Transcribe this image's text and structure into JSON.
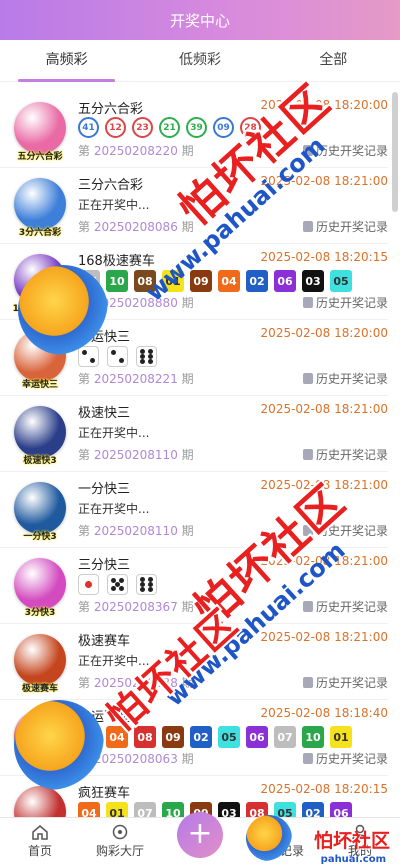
{
  "header": {
    "title": "开奖中心"
  },
  "tabs": [
    "高频彩",
    "低频彩",
    "全部"
  ],
  "active_tab": 0,
  "history_label": "历史开奖记录",
  "period_prefix": "第",
  "period_suffix": "期",
  "rows": [
    {
      "name": "五分六合彩",
      "logo_text": "五分六合彩",
      "logo_color": "#e96aa4",
      "time": "2025-02-08 18:20:00",
      "result_type": "balls",
      "balls": [
        {
          "n": "41",
          "c": "blue"
        },
        {
          "n": "12",
          "c": "red"
        },
        {
          "n": "23",
          "c": "red"
        },
        {
          "n": "21",
          "c": "green"
        },
        {
          "n": "39",
          "c": "green"
        },
        {
          "n": "09",
          "c": "blue"
        },
        {
          "n": "28",
          "c": "red"
        }
      ],
      "period": "20250208220"
    },
    {
      "name": "三分六合彩",
      "logo_text": "3分六合彩",
      "logo_color": "#3d7fd9",
      "time": "2025-02-08 18:21:00",
      "result_type": "status",
      "status": "正在开奖中...",
      "period": "20250208086"
    },
    {
      "name": "168极速赛车",
      "logo_text": "168极速赛车",
      "logo_color": "#7a3cc4",
      "time": "2025-02-08 18:20:15",
      "result_type": "squares",
      "squares": [
        {
          "n": "07",
          "bg": "#bdbdbd",
          "fg": "#fff"
        },
        {
          "n": "10",
          "bg": "#2aa74a",
          "fg": "#fff"
        },
        {
          "n": "08",
          "bg": "#7a4a1e",
          "fg": "#fff"
        },
        {
          "n": "01",
          "bg": "#f5e11c",
          "fg": "#333"
        },
        {
          "n": "09",
          "bg": "#8a3a10",
          "fg": "#fff"
        },
        {
          "n": "04",
          "bg": "#f06a1a",
          "fg": "#fff"
        },
        {
          "n": "02",
          "bg": "#1f5fc6",
          "fg": "#fff"
        },
        {
          "n": "06",
          "bg": "#8b2fd6",
          "fg": "#fff"
        },
        {
          "n": "03",
          "bg": "#111",
          "fg": "#fff"
        },
        {
          "n": "05",
          "bg": "#3fe0e0",
          "fg": "#333"
        }
      ],
      "period": "20250208880"
    },
    {
      "name": "幸运快三",
      "logo_text": "幸运快三",
      "logo_color": "#d9633a",
      "time": "2025-02-08 18:20:00",
      "result_type": "dice",
      "dice": [
        2,
        2,
        6
      ],
      "period": "20250208221"
    },
    {
      "name": "极速快三",
      "logo_text": "极速快3",
      "logo_color": "#2b3e8a",
      "time": "2025-02-08 18:21:00",
      "result_type": "status",
      "status": "正在开奖中...",
      "period": "20250208110"
    },
    {
      "name": "一分快三",
      "logo_text": "一分快3",
      "logo_color": "#1f5a9e",
      "time": "2025-02-08 18:21:00",
      "result_type": "status",
      "status": "正在开奖中...",
      "period": "20250208110"
    },
    {
      "name": "三分快三",
      "logo_text": "3分快3",
      "logo_color": "#d34bbf",
      "time": "2025-02-08 18:21:00",
      "result_type": "dice",
      "dice": [
        1,
        5,
        6
      ],
      "period": "20250208367"
    },
    {
      "name": "极速赛车",
      "logo_text": "极速赛车",
      "logo_color": "#c4451e",
      "time": "2025-02-08 18:21:00",
      "result_type": "status",
      "status": "正在开奖中...",
      "period": "20250208538"
    },
    {
      "name": "幸运飞艇",
      "logo_text": "幸运飞艇",
      "logo_color": "#d8383a",
      "time": "2025-02-08 18:18:40",
      "result_type": "squares",
      "squares": [
        {
          "n": "03",
          "bg": "#111",
          "fg": "#fff"
        },
        {
          "n": "04",
          "bg": "#f06a1a",
          "fg": "#fff"
        },
        {
          "n": "08",
          "bg": "#d73030",
          "fg": "#fff"
        },
        {
          "n": "09",
          "bg": "#8a3a10",
          "fg": "#fff"
        },
        {
          "n": "02",
          "bg": "#1f5fc6",
          "fg": "#fff"
        },
        {
          "n": "05",
          "bg": "#3fe0e0",
          "fg": "#333"
        },
        {
          "n": "06",
          "bg": "#8b2fd6",
          "fg": "#fff"
        },
        {
          "n": "07",
          "bg": "#bdbdbd",
          "fg": "#fff"
        },
        {
          "n": "10",
          "bg": "#2aa74a",
          "fg": "#fff"
        },
        {
          "n": "01",
          "bg": "#f5e11c",
          "fg": "#333"
        }
      ],
      "period": "20250208063"
    },
    {
      "name": "疯狂赛车",
      "logo_text": "疯狂赛车",
      "logo_color": "#c23030",
      "time": "2025-02-08 18:20:15",
      "result_type": "squares",
      "squares": [
        {
          "n": "04",
          "bg": "#f06a1a",
          "fg": "#fff"
        },
        {
          "n": "01",
          "bg": "#f5e11c",
          "fg": "#333"
        },
        {
          "n": "07",
          "bg": "#bdbdbd",
          "fg": "#fff"
        },
        {
          "n": "10",
          "bg": "#2aa74a",
          "fg": "#fff"
        },
        {
          "n": "09",
          "bg": "#8a3a10",
          "fg": "#fff"
        },
        {
          "n": "03",
          "bg": "#111",
          "fg": "#fff"
        },
        {
          "n": "08",
          "bg": "#d73030",
          "fg": "#fff"
        },
        {
          "n": "05",
          "bg": "#3fe0e0",
          "fg": "#333"
        },
        {
          "n": "02",
          "bg": "#1f5fc6",
          "fg": "#fff"
        },
        {
          "n": "06",
          "bg": "#8b2fd6",
          "fg": "#fff"
        }
      ],
      "period": ""
    }
  ],
  "bottom_nav": [
    {
      "label": "首页",
      "icon": "home-icon"
    },
    {
      "label": "购彩大厅",
      "icon": "lottery-hall-icon"
    },
    {
      "label": "",
      "icon": "plus-icon"
    },
    {
      "label": "开奖记录",
      "icon": "record-icon"
    },
    {
      "label": "我的",
      "icon": "user-icon"
    }
  ],
  "watermark": {
    "cn": "怕坏社区",
    "url": "www.pahuai.com",
    "badge_url": "pahuai.com"
  }
}
